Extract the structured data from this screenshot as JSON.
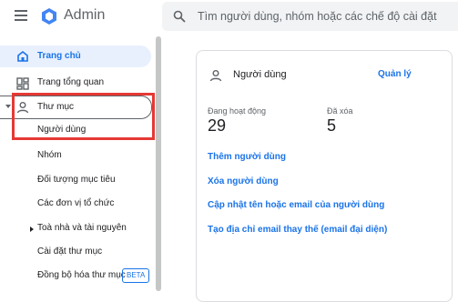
{
  "app": {
    "title": "Admin"
  },
  "search": {
    "placeholder": "Tìm người dùng, nhóm hoặc các chế độ cài đặt"
  },
  "sidebar": {
    "home": "Trang chủ",
    "dashboard": "Trang tổng quan",
    "directory": "Thư mục",
    "sub_items": [
      "Người dùng",
      "Nhóm",
      "Đối tượng mục tiêu",
      "Các đơn vị tổ chức",
      "Toà nhà và tài nguyên",
      "Cài đặt thư mục",
      "Đồng bộ hóa thư mục"
    ],
    "beta": "BETA"
  },
  "card": {
    "title": "Người dùng",
    "manage": "Quản lý",
    "active_label": "Đang hoạt động",
    "active_value": "29",
    "deleted_label": "Đã xóa",
    "deleted_value": "5",
    "links": [
      "Thêm người dùng",
      "Xóa người dùng",
      "Cập nhật tên hoặc email của người dùng",
      "Tạo địa chỉ email thay thế (email đại diện)"
    ]
  },
  "colors": {
    "accent": "#1a73e8",
    "highlight_box": "#e53935",
    "selected_bg": "#e8f0fe"
  }
}
